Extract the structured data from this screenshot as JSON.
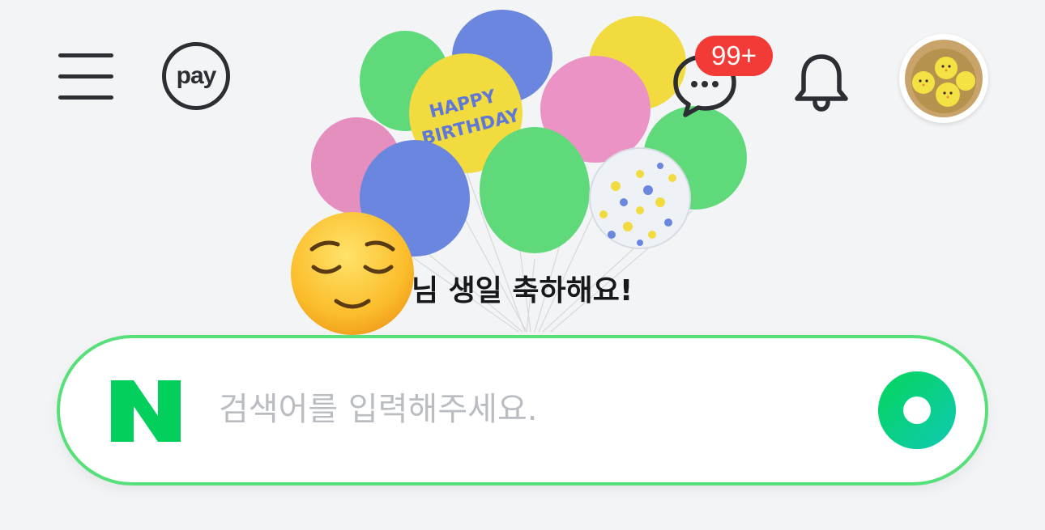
{
  "header": {
    "menu_icon": "hamburger-menu-icon",
    "pay_label": "pay",
    "talk_icon": "chat-bubble-icon",
    "talk_badge": "99+",
    "bell_icon": "bell-icon",
    "avatar_icon": "profile-avatar-chicks"
  },
  "birthday": {
    "balloon_text_line1": "HAPPY",
    "balloon_text_line2": "BIRTHDAY",
    "greeting": "님 생일 축하해요!",
    "emoji": "😌"
  },
  "search": {
    "logo_letter": "N",
    "placeholder": "검색어를 입력해주세요.",
    "value": "",
    "submit_icon": "green-ring-search-icon"
  },
  "colors": {
    "accent_green": "#03cf5d",
    "border_green": "#57e079",
    "badge_red": "#f23a36",
    "icon_dark": "#2b2e33",
    "placeholder_gray": "#b9bdc2"
  }
}
